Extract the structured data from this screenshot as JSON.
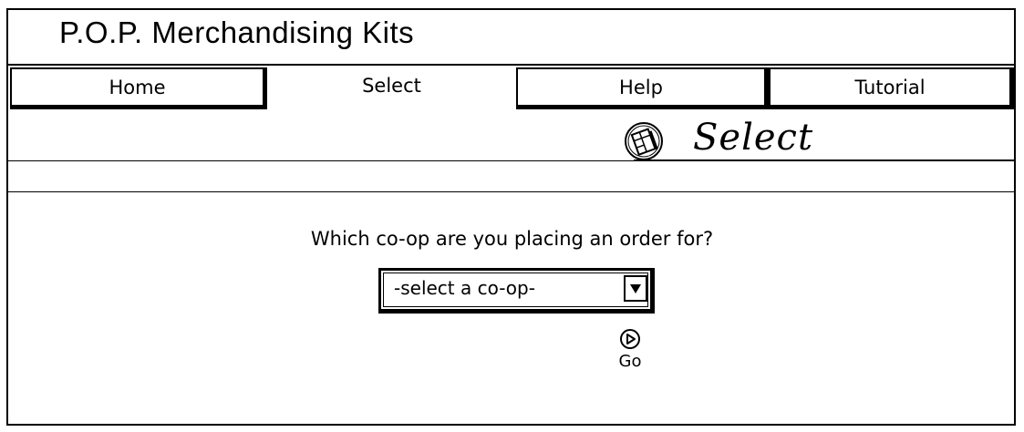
{
  "app": {
    "title": "P.O.P.  Merchandising Kits"
  },
  "tabs": [
    {
      "label": "Home",
      "selected": false
    },
    {
      "label": "Select",
      "selected": true
    },
    {
      "label": "Help",
      "selected": false
    },
    {
      "label": "Tutorial",
      "selected": false
    }
  ],
  "header": {
    "title": "Select",
    "icon": "select-page-icon"
  },
  "main": {
    "question": "Which co-op are you placing an order for?",
    "coop_select": {
      "value": "-select a co-op-",
      "icon": "chevron-down-icon"
    },
    "go": {
      "label": "Go",
      "icon": "go-arrow-icon"
    }
  }
}
